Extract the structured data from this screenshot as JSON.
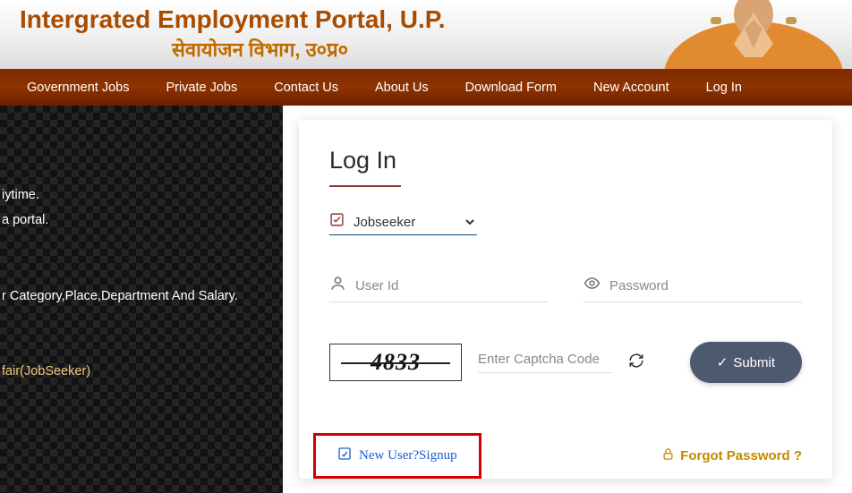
{
  "header": {
    "title": "Intergrated Employment Portal, U.P.",
    "subtitle": "सेवायोजन विभाग, उ०प्र०"
  },
  "nav": {
    "items": [
      "Government Jobs",
      "Private Jobs",
      "Contact Us",
      "About Us",
      "Download Form",
      "New Account",
      "Log In"
    ]
  },
  "left": {
    "line1": "iytime.",
    "line2": "a portal.",
    "line3": "r Category,Place,Department And Salary.",
    "link": "fair(JobSeeker)"
  },
  "login": {
    "title": "Log In",
    "role_option": "Jobseeker",
    "userid_placeholder": "User Id",
    "password_placeholder": "Password",
    "captcha_value": "4833",
    "captcha_placeholder": "Enter Captcha Code",
    "submit_label": "Submit",
    "signup_label": "New  User?Signup",
    "forgot_label": "Forgot Password ?"
  }
}
